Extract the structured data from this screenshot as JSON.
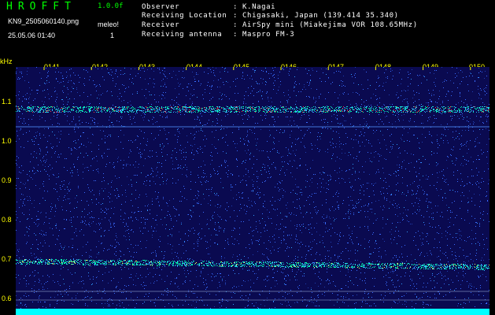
{
  "header": {
    "logo": "HROFFT",
    "version": "1.0.0f",
    "filename": "KN9_2505060140.png",
    "datetime": "25.05.06 01:40",
    "meleo_label": "meleo!",
    "meleo_value": "1"
  },
  "info": [
    {
      "label": "Observer",
      "value": ": K.Nagai"
    },
    {
      "label": "Receiving Location",
      "value": ": Chigasaki, Japan (139.414 35.340)"
    },
    {
      "label": "Receiver",
      "value": ": AirSpy mini (Miakejima VOR 108.65MHz)"
    },
    {
      "label": "Receiving antenna",
      "value": ": Maspro FM-3"
    }
  ],
  "spectrogram": {
    "y_unit": "kHz",
    "y_ticks": [
      "1.1",
      "1.0",
      "0.9",
      "0.8",
      "0.7",
      "0.6"
    ],
    "x_ticks": [
      "0141",
      "0142",
      "0143",
      "0144",
      "0145",
      "0146",
      "0147",
      "0148",
      "0149",
      "0150"
    ],
    "colors": {
      "background": "#0a0a50",
      "noise": "#3a6dff",
      "signal": "#00ffaa",
      "hot": "#ff4040",
      "tick_text": "#ffff00",
      "baseline": "#00ffff"
    }
  }
}
